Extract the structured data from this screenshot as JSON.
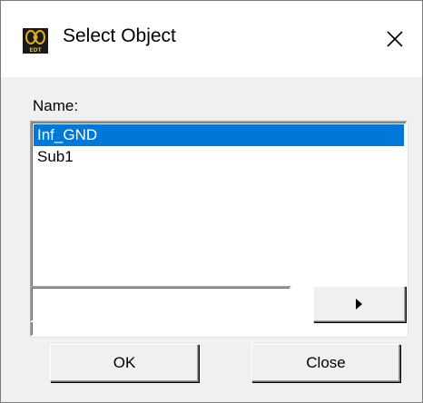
{
  "window": {
    "title": "Select Object",
    "icon": "edt-app-icon",
    "close_icon": "close-icon"
  },
  "form": {
    "name_label": "Name:",
    "items": [
      {
        "label": "Inf_GND",
        "selected": true
      },
      {
        "label": "Sub1",
        "selected": false
      }
    ],
    "input_value": "",
    "arrow_icon": "triangle-right-icon"
  },
  "buttons": {
    "ok": "OK",
    "close": "Close"
  },
  "colors": {
    "selection": "#0078d7",
    "dialog_bg": "#f0f0f0"
  }
}
